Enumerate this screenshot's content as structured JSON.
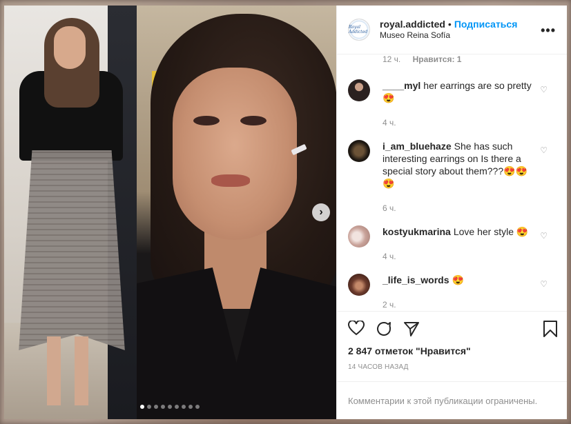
{
  "post": {
    "username": "royal.addicted",
    "separator": "•",
    "follow_label": "Подписаться",
    "location": "Museo Reina Sofía",
    "more_label": "•••",
    "avatar_text": "Royal Addicted"
  },
  "top_meta": {
    "time": "12 ч.",
    "likes": "Нравится: 1"
  },
  "comments": [
    {
      "username": "____myl",
      "text": "her earrings are so pretty 😍",
      "time": "4 ч.",
      "avatar_color": "#2a2120"
    },
    {
      "username": "i_am_bluehaze",
      "text": "She has such interesting earrings on Is there a special story about them???😍😍😍",
      "time": "6 ч.",
      "avatar_color": "#3b2e1e"
    },
    {
      "username": "kostyukmarina",
      "text": "Love her style 😍",
      "time": "4 ч.",
      "avatar_color": "#c9a39a"
    },
    {
      "username": "_life_is_words",
      "text": "😍",
      "time": "2 ч.",
      "avatar_color": "#6b3a2c"
    }
  ],
  "actions": {
    "likes_count": "2 847 отметок \"Нравится\"",
    "timestamp": "14 ЧАСОВ НАЗАД",
    "restricted": "Комментарии к этой публикации ограничены."
  },
  "carousel": {
    "total": 9,
    "active": 1,
    "next_label": "›"
  },
  "colors": {
    "accent": "#0095f6",
    "muted": "#8e8e8e",
    "text": "#262626"
  }
}
